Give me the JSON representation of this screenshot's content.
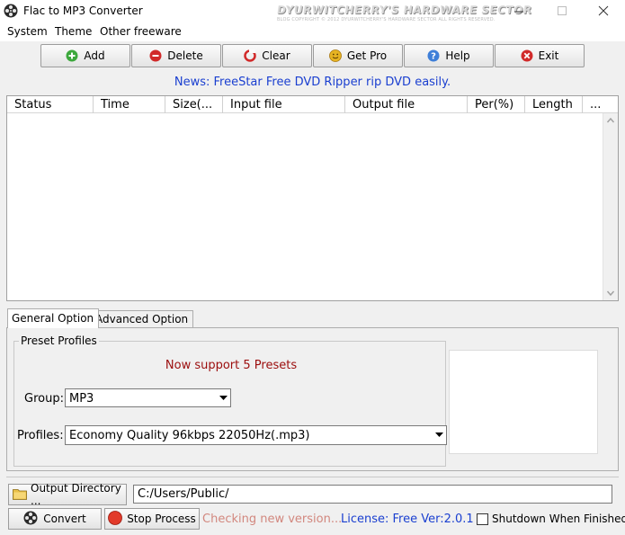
{
  "window": {
    "title": "Flac to MP3 Converter",
    "watermark_line1": "DYURWITCHERRY'S HARDWARE SECTOR",
    "watermark_line2": "BLOG COPYRIGHT © 2012 DYURWITCHERRY'S HARDWARE SECTOR ALL RIGHTS RESERVED."
  },
  "menu": [
    "System",
    "Theme",
    "Other freeware"
  ],
  "toolbar": {
    "add": "Add",
    "delete": "Delete",
    "clear": "Clear",
    "getpro": "Get Pro",
    "help": "Help",
    "exit": "Exit"
  },
  "news": "News: FreeStar Free DVD Ripper rip DVD easily.",
  "columns": [
    "Status",
    "Time",
    "Size(...",
    "Input file",
    "Output file",
    "Per(%)",
    "Length",
    "..."
  ],
  "tabs": {
    "general": "General Option",
    "advanced": "Advanced Option"
  },
  "preset": {
    "legend": "Preset Profiles",
    "support": "Now support 5 Presets",
    "group_label": "Group:",
    "group_value": "MP3",
    "profiles_label": "Profiles:",
    "profiles_value": "Economy Quality 96kbps 22050Hz(.mp3)"
  },
  "output": {
    "button": "Output Directory ...",
    "path": "C:/Users/Public/"
  },
  "bottom": {
    "convert": "Convert",
    "stop": "Stop Process",
    "checking": "Checking new version...",
    "license": "License: Free Ver:2.0.1",
    "shutdown": "Shutdown When Finished"
  },
  "colors": {
    "news": "#1a3fd0",
    "support": "#9b0d0d",
    "checking": "#d2877e",
    "license": "#1a3fd0"
  }
}
